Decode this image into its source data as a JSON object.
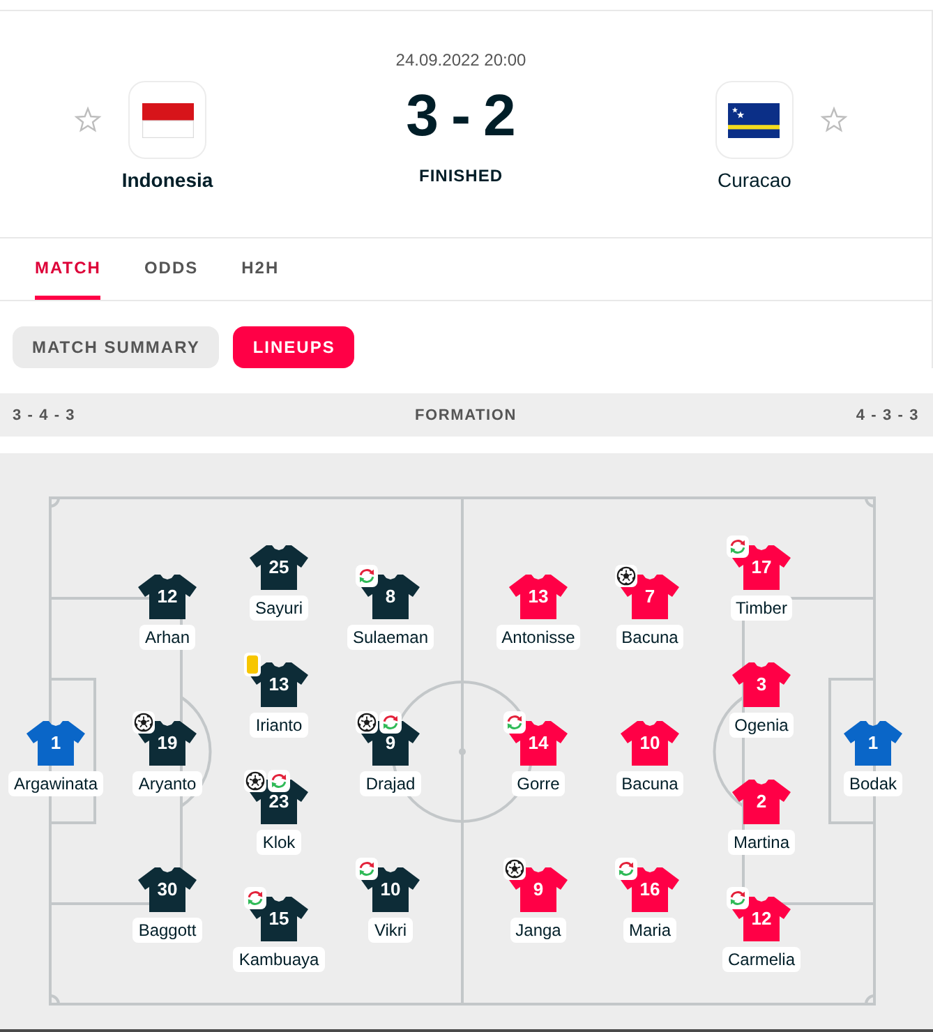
{
  "header": {
    "date": "24.09.2022 20:00",
    "score": {
      "home": "3",
      "separator": "-",
      "away": "2"
    },
    "status": "FINISHED",
    "teams": [
      {
        "name": "Indonesia",
        "favorite": false,
        "winner": true
      },
      {
        "name": "Curacao",
        "favorite": false,
        "winner": false
      }
    ]
  },
  "tabs": [
    {
      "label": "MATCH",
      "selected": true
    },
    {
      "label": "ODDS",
      "selected": false
    },
    {
      "label": "H2H",
      "selected": false
    }
  ],
  "subtabs": [
    {
      "label": "MATCH SUMMARY",
      "selected": false
    },
    {
      "label": "LINEUPS",
      "selected": true
    }
  ],
  "formation": {
    "home": "3 - 4 - 3",
    "label": "FORMATION",
    "away": "4 - 3 - 3"
  },
  "lineups": {
    "teams": [
      {
        "color": "#0d2c37",
        "lines": [
          {
            "kind": "goalkeeper",
            "players": [
              {
                "number": "1",
                "name": "Argawinata"
              }
            ]
          },
          {
            "kind": "outfield",
            "players": [
              {
                "number": "12",
                "name": "Arhan"
              },
              {
                "number": "19",
                "name": "Aryanto",
                "events": [
                  {
                    "kind": "goal"
                  }
                ]
              },
              {
                "number": "30",
                "name": "Baggott"
              }
            ]
          },
          {
            "kind": "outfield",
            "players": [
              {
                "number": "25",
                "name": "Sayuri"
              },
              {
                "number": "13",
                "name": "Irianto",
                "events": [
                  {
                    "kind": "yellow_card"
                  }
                ]
              },
              {
                "number": "23",
                "name": "Klok",
                "events": [
                  {
                    "kind": "goal"
                  },
                  {
                    "kind": "substitution"
                  }
                ]
              },
              {
                "number": "15",
                "name": "Kambuaya",
                "events": [
                  {
                    "kind": "substitution"
                  }
                ]
              }
            ]
          },
          {
            "kind": "outfield",
            "players": [
              {
                "number": "8",
                "name": "Sulaeman",
                "events": [
                  {
                    "kind": "substitution"
                  }
                ]
              },
              {
                "number": "9",
                "name": "Drajad",
                "events": [
                  {
                    "kind": "goal"
                  },
                  {
                    "kind": "substitution"
                  }
                ]
              },
              {
                "number": "10",
                "name": "Vikri",
                "events": [
                  {
                    "kind": "substitution"
                  }
                ]
              }
            ]
          }
        ]
      },
      {
        "color": "#ff0046",
        "lines": [
          {
            "kind": "outfield",
            "players": [
              {
                "number": "13",
                "name": "Antonisse"
              },
              {
                "number": "14",
                "name": "Gorre",
                "events": [
                  {
                    "kind": "substitution"
                  }
                ]
              },
              {
                "number": "9",
                "name": "Janga",
                "events": [
                  {
                    "kind": "goal"
                  }
                ]
              }
            ]
          },
          {
            "kind": "outfield",
            "players": [
              {
                "number": "7",
                "name": "Bacuna",
                "events": [
                  {
                    "kind": "goal"
                  }
                ]
              },
              {
                "number": "10",
                "name": "Bacuna"
              },
              {
                "number": "16",
                "name": "Maria",
                "events": [
                  {
                    "kind": "substitution"
                  }
                ]
              }
            ]
          },
          {
            "kind": "outfield",
            "players": [
              {
                "number": "17",
                "name": "Timber",
                "events": [
                  {
                    "kind": "substitution"
                  }
                ]
              },
              {
                "number": "3",
                "name": "Ogenia"
              },
              {
                "number": "2",
                "name": "Martina"
              },
              {
                "number": "12",
                "name": "Carmelia",
                "events": [
                  {
                    "kind": "substitution"
                  }
                ]
              }
            ]
          },
          {
            "kind": "goalkeeper",
            "players": [
              {
                "number": "1",
                "name": "Bodak"
              }
            ]
          }
        ]
      }
    ]
  }
}
